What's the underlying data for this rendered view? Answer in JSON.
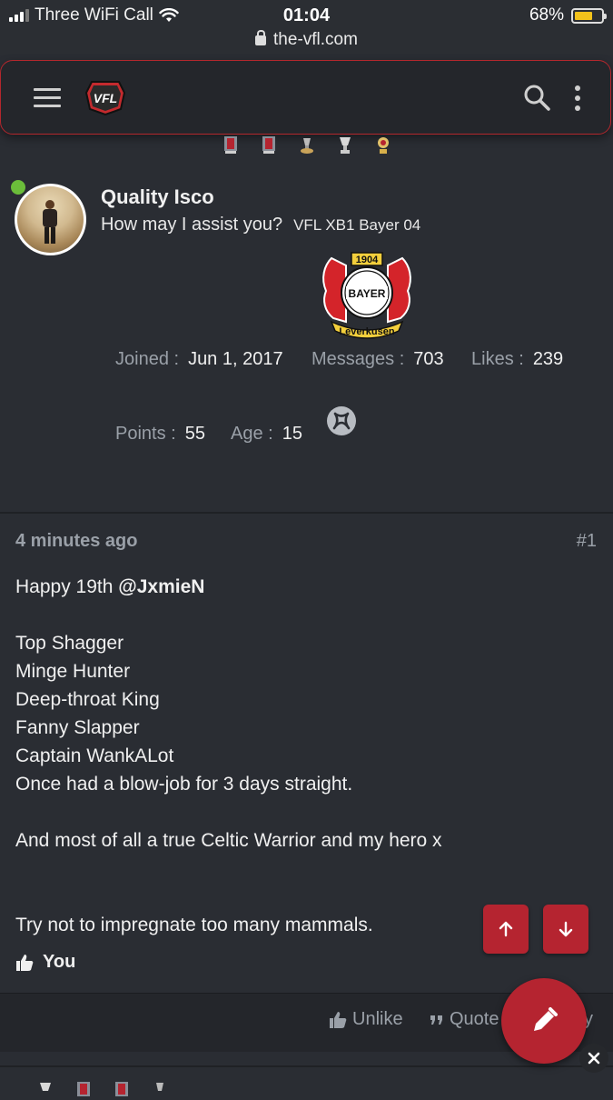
{
  "status_bar": {
    "carrier": "Three WiFi Call",
    "time": "01:04",
    "battery": "68%",
    "battery_level": 0.68,
    "url": "the-vfl.com"
  },
  "navbar": {
    "logo_text": "VFL"
  },
  "profile": {
    "username": "Quality Isco",
    "user_title": "How may I assist you?",
    "banner": "VFL XB1 Bayer 04",
    "crest": {
      "year": "1904",
      "name": "BAYER",
      "ribbon": "Leverkusen"
    },
    "stats": {
      "joined_label": "Joined :",
      "joined_value": "Jun 1, 2017",
      "messages_label": "Messages :",
      "messages_value": "703",
      "likes_label": "Likes :",
      "likes_value": "239",
      "points_label": "Points :",
      "points_value": "55",
      "age_label": "Age :",
      "age_value": "15"
    }
  },
  "post": {
    "time": "4 minutes ago",
    "number": "#1",
    "line1_text": "Happy 19th ",
    "line1_mention": "@JxmieN",
    "lines_block1": [
      "Top Shagger",
      "Minge Hunter",
      "Deep-throat King",
      "Fanny Slapper",
      "Captain WankALot",
      "Once had a blow-job for 3 days straight."
    ],
    "line_hero": "And most of all a true Celtic Warrior and my hero x",
    "line_last": "Try not to impregnate too many mammals.",
    "liked_by": "You"
  },
  "actions": {
    "unlike": "Unlike",
    "quote": "Quote",
    "reply_partial": "y"
  },
  "colors": {
    "accent": "#b52430",
    "online": "#6bbd3a",
    "background": "#2a2d33"
  }
}
